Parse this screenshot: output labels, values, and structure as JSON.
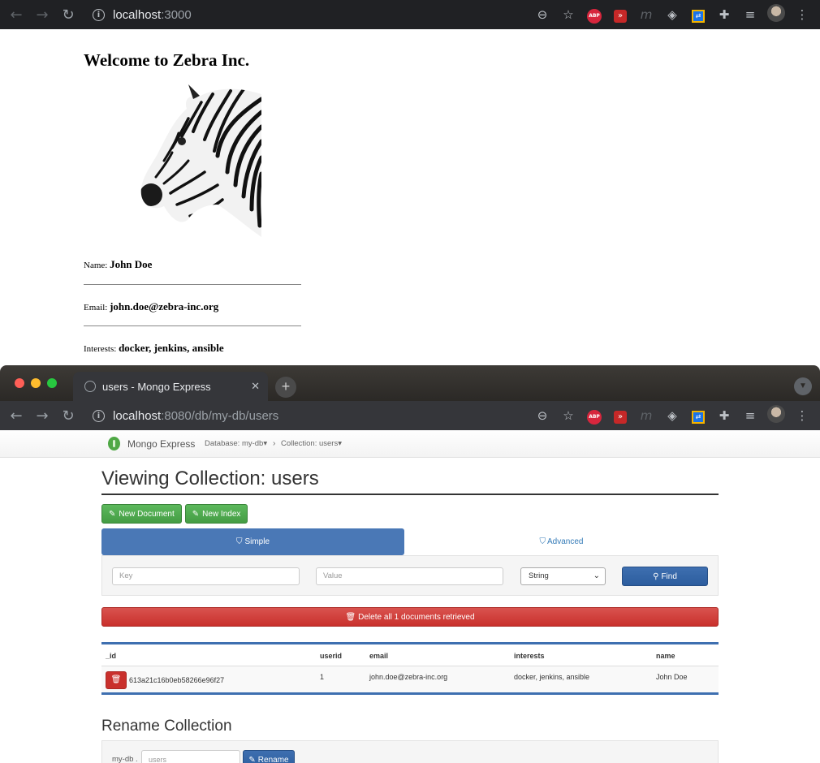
{
  "browser_top": {
    "url_host": "localhost",
    "url_path": ":3000"
  },
  "zebra_page": {
    "heading": "Welcome to Zebra Inc.",
    "name_label": "Name:",
    "name_value": "John Doe",
    "email_label": "Email:",
    "email_value": "john.doe@zebra-inc.org",
    "interests_label": "Interests:",
    "interests_value": "docker, jenkins, ansible"
  },
  "browser_bottom": {
    "tab_title": "users - Mongo Express",
    "url_host": "localhost",
    "url_path": ":8080/db/my-db/users"
  },
  "mongo": {
    "brand": "Mongo Express",
    "crumb_db": "Database: my-db",
    "crumb_collection": "Collection: users",
    "title": "Viewing Collection: users",
    "new_document": "New Document",
    "new_index": "New Index",
    "tab_simple": "Simple",
    "tab_advanced": "Advanced",
    "key_placeholder": "Key",
    "value_placeholder": "Value",
    "type_select": "String",
    "find": "Find",
    "delete_all": "Delete all 1 documents retrieved",
    "columns": [
      "_id",
      "userid",
      "email",
      "interests",
      "name"
    ],
    "rows": [
      {
        "_id": "613a21c16b0eb58266e96f27",
        "userid": "1",
        "email": "john.doe@zebra-inc.org",
        "interests": "docker, jenkins, ansible",
        "name": "John Doe"
      }
    ],
    "rename_title": "Rename Collection",
    "rename_db_label": "my-db .",
    "rename_placeholder": "users",
    "rename_button": "Rename"
  }
}
